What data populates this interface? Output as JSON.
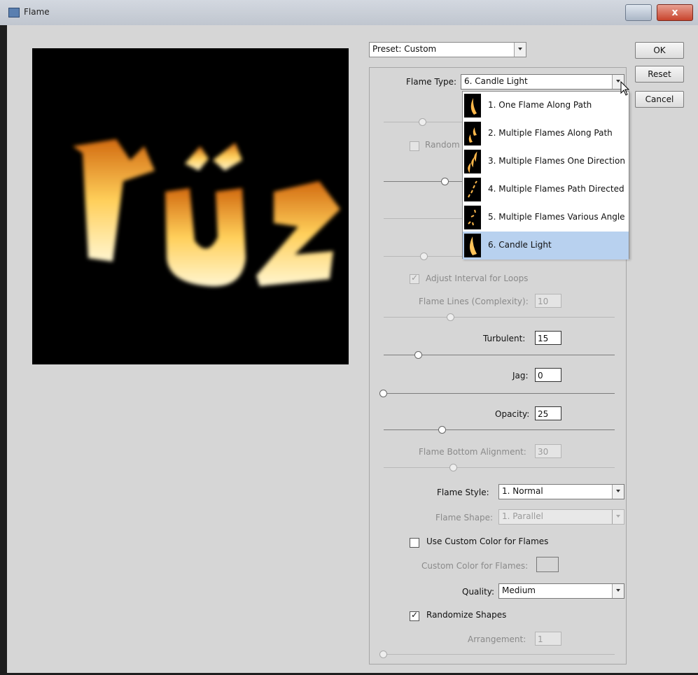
{
  "window": {
    "title": "Flame",
    "close_label": "x"
  },
  "preview": {
    "text": "rüz"
  },
  "preset": {
    "value": "Preset: Custom"
  },
  "buttons": {
    "ok": "OK",
    "reset": "Reset",
    "cancel": "Cancel"
  },
  "flame_type": {
    "label": "Flame Type:",
    "value": "6. Candle Light",
    "options": [
      "1. One Flame Along Path",
      "2. Multiple Flames Along Path",
      "3. Multiple Flames One Direction",
      "4. Multiple Flames Path Directed",
      "5. Multiple Flames Various Angle",
      "6. Candle Light"
    ]
  },
  "randomize_partial": "Random",
  "adjust_interval": {
    "label": "Adjust Interval for Loops",
    "checked": true
  },
  "flame_lines": {
    "label": "Flame Lines (Complexity):",
    "value": "10"
  },
  "turbulent": {
    "label": "Turbulent:",
    "value": "15"
  },
  "jag": {
    "label": "Jag:",
    "value": "0"
  },
  "opacity": {
    "label": "Opacity:",
    "value": "25"
  },
  "flame_bottom": {
    "label": "Flame Bottom Alignment:",
    "value": "30"
  },
  "flame_style": {
    "label": "Flame Style:",
    "value": "1. Normal"
  },
  "flame_shape": {
    "label": "Flame Shape:",
    "value": "1. Parallel"
  },
  "custom_color": {
    "label": "Use Custom Color for Flames",
    "checked": false
  },
  "custom_color_field": {
    "label": "Custom Color for Flames:"
  },
  "quality": {
    "label": "Quality:",
    "value": "Medium"
  },
  "randomize_shapes": {
    "label": "Randomize Shapes",
    "checked": true
  },
  "arrangement": {
    "label": "Arrangement:",
    "value": "1"
  },
  "check_mark": "✓"
}
